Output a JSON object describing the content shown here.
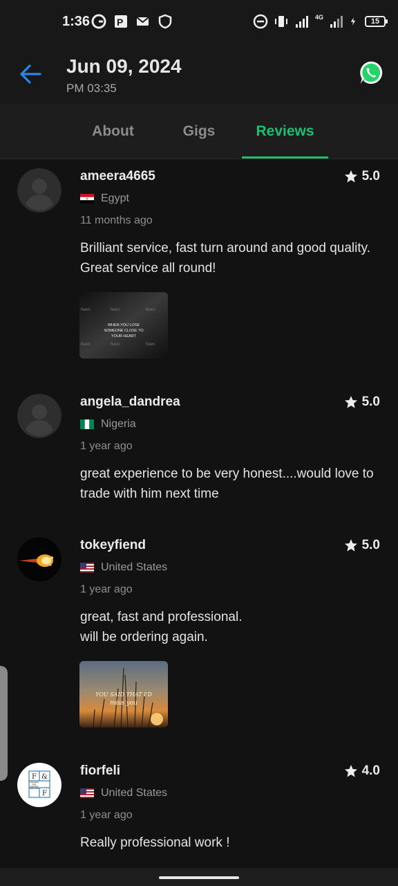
{
  "status_bar": {
    "time": "1:36",
    "network": "4G",
    "battery": "15"
  },
  "header": {
    "date": "Jun 09, 2024",
    "time": "PM 03:35",
    "back_icon": "arrow-left-icon",
    "whatsapp_icon": "whatsapp-icon"
  },
  "tabs": [
    {
      "label": "About",
      "active": false
    },
    {
      "label": "Gigs",
      "active": false
    },
    {
      "label": "Reviews",
      "active": true
    }
  ],
  "accent_color": "#1dbf73",
  "reviews": [
    {
      "username": "ameera4665",
      "rating": "5.0",
      "country": "Egypt",
      "time_ago": "11 months ago",
      "comment": "Brilliant service, fast turn around and good quality. Great service all round!",
      "attachment": {
        "watermark": "fiverr.",
        "caption_lines": [
          "WHEN YOU LOSE",
          "SOMEONE CLOSE TO",
          "YOUR HEART"
        ]
      }
    },
    {
      "username": "angela_dandrea",
      "rating": "5.0",
      "country": "Nigeria",
      "time_ago": "1 year ago",
      "comment": "great experience to be very honest....would love to trade with him next time"
    },
    {
      "username": "tokeyfiend",
      "rating": "5.0",
      "country": "United States",
      "time_ago": "1 year ago",
      "comment_lines": [
        "great, fast and professional.",
        "will be ordering again."
      ],
      "attachment": {
        "caption_lines": [
          "YOU SAID THAT I'D",
          "miss you"
        ]
      }
    },
    {
      "username": "fiorfeli",
      "rating": "4.0",
      "country": "United States",
      "time_ago": "1 year ago",
      "comment": "Really professional work !",
      "avatar_logo": {
        "letters": [
          "F",
          "&",
          "",
          "F"
        ],
        "subtitle_lines": [
          "CLEANING",
          "AND",
          "PAINTING",
          "SERVICES"
        ]
      }
    }
  ]
}
